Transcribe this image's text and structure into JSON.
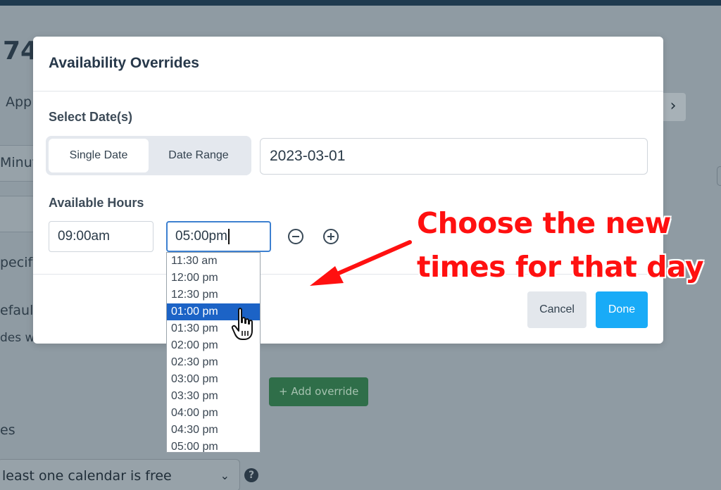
{
  "background": {
    "title_fragment": "74",
    "app_text": "App",
    "minute_text": "Minut",
    "specify_text": "pecify",
    "default_text": "efault",
    "des_text": "des w",
    "es_text": "es",
    "add_override_label": "+ Add override",
    "calendar_select_value": "least one calendar is free",
    "help_icon": "?",
    "next_icon": "chevron-right-icon"
  },
  "modal": {
    "title": "Availability Overrides",
    "select_dates_label": "Select Date(s)",
    "toggle": {
      "single_date": "Single Date",
      "date_range": "Date Range",
      "active": "single_date"
    },
    "date_value": "2023-03-01",
    "available_hours_label": "Available Hours",
    "start_time": "09:00am",
    "end_time": "05:00pm",
    "cancel_label": "Cancel",
    "done_label": "Done"
  },
  "dropdown": {
    "options": [
      "11:30 am",
      "12:00 pm",
      "12:30 pm",
      "01:00 pm",
      "01:30 pm",
      "02:00 pm",
      "02:30 pm",
      "03:00 pm",
      "03:30 pm",
      "04:00 pm",
      "04:30 pm",
      "05:00 pm"
    ],
    "highlighted": "01:00 pm"
  },
  "annotation": {
    "line1": "Choose the new",
    "line2": "times for that day",
    "color": "#ff1010"
  },
  "colors": {
    "accent": "#19abf7",
    "selected_option": "#1c63c6",
    "focus_border": "#3d80d0"
  }
}
